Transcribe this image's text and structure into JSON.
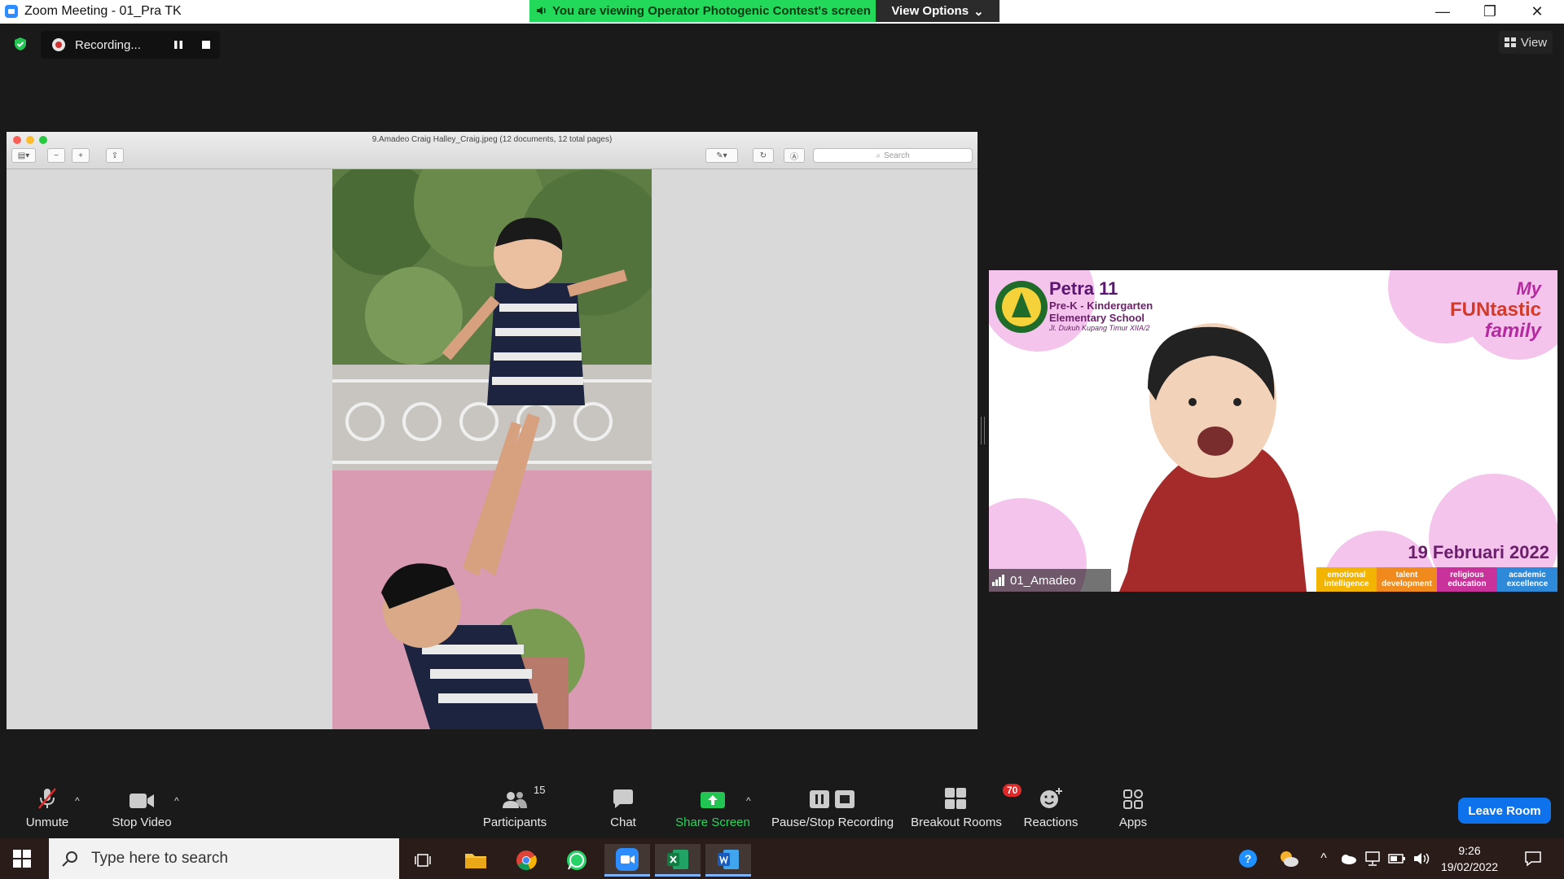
{
  "window": {
    "title": "Zoom Meeting - 01_Pra TK"
  },
  "share_banner": {
    "text": "You are viewing Operator Photogenic Contest's screen",
    "view_options": "View Options"
  },
  "recording": {
    "label": "Recording..."
  },
  "view_button": {
    "label": "View"
  },
  "shared_window": {
    "title": "9.Amadeo Craig Halley_Craig.jpeg (12 documents, 12 total pages)",
    "search_placeholder": "Search"
  },
  "participant": {
    "name": "01_Amadeo",
    "school_name": "Petra 11",
    "school_line2": "Pre-K - Kindergarten",
    "school_line3": "Elementary School",
    "school_address": "Jl. Dukuh Kupang Timur XIIA/2",
    "theme_line1": "My",
    "theme_line2": "FUNtastic",
    "theme_line3": "family",
    "date": "19 Februari 2022",
    "tags": [
      {
        "label": "emotional intelligence",
        "color": "#f2b400"
      },
      {
        "label": "talent development",
        "color": "#f08a1c"
      },
      {
        "label": "religious education",
        "color": "#c8329a"
      },
      {
        "label": "academic excellence",
        "color": "#2e8ad8"
      }
    ]
  },
  "toolbar": {
    "unmute": "Unmute",
    "stop_video": "Stop Video",
    "participants": "Participants",
    "participants_count": "15",
    "chat": "Chat",
    "share_screen": "Share Screen",
    "pause_stop_recording": "Pause/Stop Recording",
    "breakout_rooms": "Breakout Rooms",
    "breakout_badge": "70",
    "reactions": "Reactions",
    "apps": "Apps",
    "leave_room": "Leave Room"
  },
  "taskbar": {
    "search_placeholder": "Type here to search",
    "time": "9:26",
    "date": "19/02/2022"
  },
  "colors": {
    "zoom_blue": "#0e72ed",
    "share_green": "#23d959",
    "taskbar_bg": "#2a1c19"
  }
}
